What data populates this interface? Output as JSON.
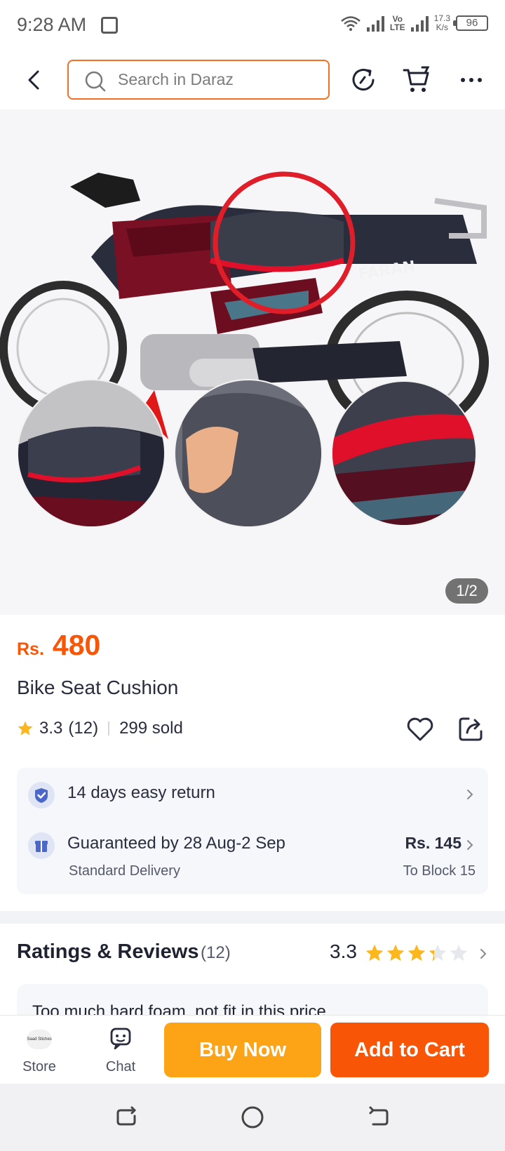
{
  "status_bar": {
    "time": "9:28 AM",
    "volte_top": "Vo",
    "volte_bottom": "LTE",
    "net_speed_value": "17.3",
    "net_speed_unit": "K/s",
    "battery": "96"
  },
  "top_nav": {
    "search_placeholder": "Search in Daraz",
    "icons": [
      "back-arrow-icon",
      "search-icon",
      "recent-icon",
      "cart-icon",
      "more-icon"
    ]
  },
  "gallery": {
    "watermark": "FARAN",
    "page_indicator": "1/2"
  },
  "product": {
    "currency": "Rs.",
    "price": "480",
    "title": "Bike Seat Cushion",
    "rating": "3.3",
    "rating_count": "(12)",
    "sold": "299 sold"
  },
  "service": {
    "return_text": "14 days easy return",
    "delivery_text": "Guaranteed by 28 Aug-2 Sep",
    "delivery_type": "Standard Delivery",
    "delivery_fee": "Rs. 145",
    "delivery_location": "To Block 15"
  },
  "reviews": {
    "title": "Ratings & Reviews",
    "count": "(12)",
    "score": "3.3",
    "stars_value": 3.3,
    "first_review": "Too much hard foam, not fit in this price"
  },
  "actions": {
    "store_label": "Store",
    "store_logo_text": "Saad Stiches",
    "chat_label": "Chat",
    "buy_now": "Buy Now",
    "add_to_cart": "Add to Cart"
  },
  "colors": {
    "accent_orange": "#f85606",
    "buy_now_yellow": "#fca316",
    "search_border": "#f36f21",
    "star_yellow": "#fcb71e"
  }
}
